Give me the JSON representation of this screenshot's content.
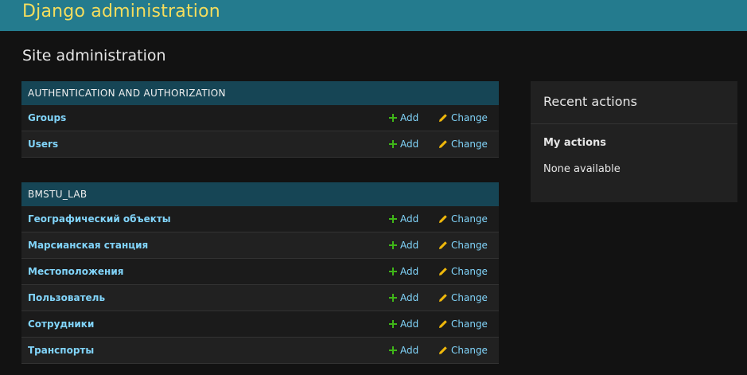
{
  "header": {
    "branding": "Django administration"
  },
  "main": {
    "title": "Site administration",
    "modules": [
      {
        "caption": "AUTHENTICATION AND AUTHORIZATION",
        "rows": [
          {
            "name": "Groups",
            "add": "Add",
            "change": "Change"
          },
          {
            "name": "Users",
            "add": "Add",
            "change": "Change"
          }
        ]
      },
      {
        "caption": "BMSTU_LAB",
        "rows": [
          {
            "name": "Географический объекты",
            "add": "Add",
            "change": "Change"
          },
          {
            "name": "Марсианская станция",
            "add": "Add",
            "change": "Change"
          },
          {
            "name": "Местоположения",
            "add": "Add",
            "change": "Change"
          },
          {
            "name": "Пользователь",
            "add": "Add",
            "change": "Change"
          },
          {
            "name": "Сотрудники",
            "add": "Add",
            "change": "Change"
          },
          {
            "name": "Транспорты",
            "add": "Add",
            "change": "Change"
          }
        ]
      }
    ]
  },
  "sidebar": {
    "title": "Recent actions",
    "subtitle": "My actions",
    "empty_text": "None available"
  },
  "colors": {
    "header_bg": "#247b8e",
    "branding": "#f5dd5d",
    "caption_bg": "#164555",
    "link": "#81d4fa",
    "add_icon": "#3fb618",
    "change_icon": "#efb80b",
    "page_bg": "#121212"
  },
  "icons": {
    "add": "plus-icon",
    "change": "pencil-icon"
  }
}
